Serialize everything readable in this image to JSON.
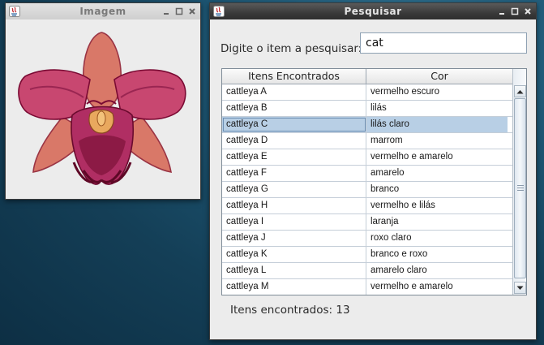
{
  "colors": {
    "selection": "#b8cfe5",
    "active_title_bg": "#3a3a3a",
    "inactive_title_bg": "#d6d6d6",
    "orchid_petals": "#d97868",
    "orchid_lip": "#c13a69",
    "orchid_dark": "#7a0a33"
  },
  "image_window": {
    "title": "Imagem",
    "icon": "java-app-icon",
    "image_semantic": "cattleya-orchid-illustration"
  },
  "search_window": {
    "title": "Pesquisar",
    "icon": "java-app-icon",
    "prompt_label": "Digite o item a pesquisar:",
    "search_value": "cat",
    "columns": [
      "Itens Encontrados",
      "Cor"
    ],
    "rows": [
      [
        "cattleya A",
        "vermelho escuro"
      ],
      [
        "cattleya B",
        "lilás"
      ],
      [
        "cattleya C",
        "lilás claro"
      ],
      [
        "cattleya D",
        "marrom"
      ],
      [
        "cattleya E",
        "vermelho e amarelo"
      ],
      [
        "cattleya F",
        "amarelo"
      ],
      [
        "cattleya G",
        "branco"
      ],
      [
        "cattleya H",
        "vermelho e lilás"
      ],
      [
        "cattleya I",
        "laranja"
      ],
      [
        "cattleya J",
        "roxo claro"
      ],
      [
        "cattleya K",
        "branco e roxo"
      ],
      [
        "cattleya L",
        "amarelo claro"
      ],
      [
        "cattleya M",
        "vermelho e amarelo"
      ]
    ],
    "selected_row": 2,
    "status_text": "Itens encontrados: 13"
  },
  "window_controls": [
    "minimize-icon",
    "maximize-icon",
    "close-icon"
  ]
}
